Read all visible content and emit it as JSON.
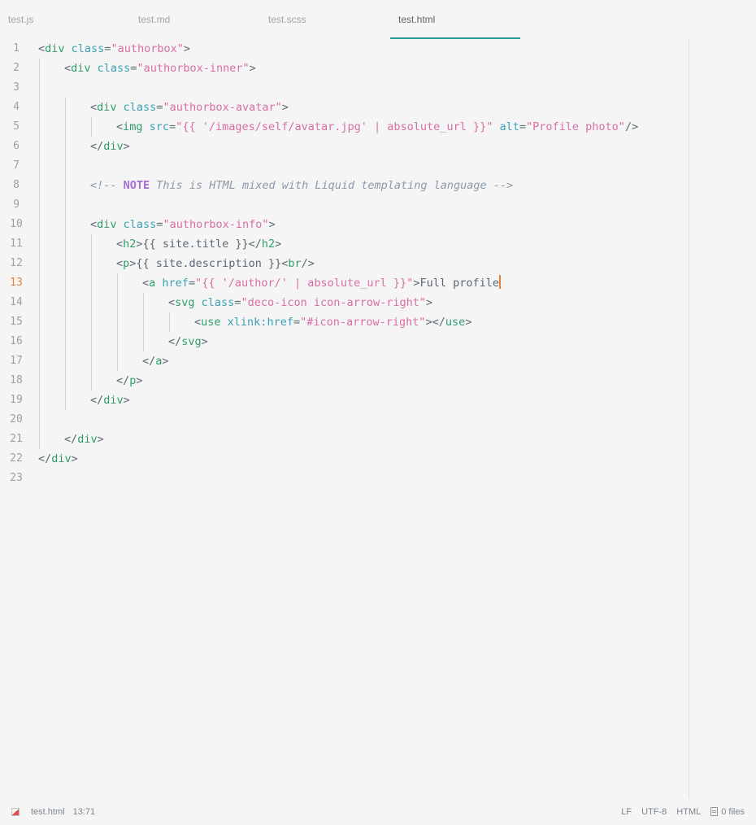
{
  "tabs": [
    {
      "label": "test.js"
    },
    {
      "label": "test.md"
    },
    {
      "label": "test.scss"
    },
    {
      "label": "test.html",
      "active": true
    }
  ],
  "editor": {
    "current_line": 13,
    "line_numbers": [
      "1",
      "2",
      "3",
      "4",
      "5",
      "6",
      "7",
      "8",
      "9",
      "10",
      "11",
      "12",
      "13",
      "14",
      "15",
      "16",
      "17",
      "18",
      "19",
      "20",
      "21",
      "22",
      "23"
    ],
    "lines": [
      {
        "indent": 0,
        "tokens": [
          [
            "punct",
            "<"
          ],
          [
            "tag",
            "div"
          ],
          [
            "text",
            " "
          ],
          [
            "attr",
            "class"
          ],
          [
            "punct",
            "="
          ],
          [
            "str",
            "\"authorbox\""
          ],
          [
            "punct",
            ">"
          ]
        ]
      },
      {
        "indent": 1,
        "tokens": [
          [
            "punct",
            "<"
          ],
          [
            "tag",
            "div"
          ],
          [
            "text",
            " "
          ],
          [
            "attr",
            "class"
          ],
          [
            "punct",
            "="
          ],
          [
            "str",
            "\"authorbox-inner\""
          ],
          [
            "punct",
            ">"
          ]
        ]
      },
      {
        "indent": 0,
        "guides": 1,
        "tokens": []
      },
      {
        "indent": 2,
        "tokens": [
          [
            "punct",
            "<"
          ],
          [
            "tag",
            "div"
          ],
          [
            "text",
            " "
          ],
          [
            "attr",
            "class"
          ],
          [
            "punct",
            "="
          ],
          [
            "str",
            "\"authorbox-avatar\""
          ],
          [
            "punct",
            ">"
          ]
        ]
      },
      {
        "indent": 3,
        "tokens": [
          [
            "punct",
            "<"
          ],
          [
            "tag",
            "img"
          ],
          [
            "text",
            " "
          ],
          [
            "attr",
            "src"
          ],
          [
            "punct",
            "="
          ],
          [
            "str",
            "\"{{ '/images/self/avatar.jpg' | absolute_url }}\""
          ],
          [
            "text",
            " "
          ],
          [
            "attr",
            "alt"
          ],
          [
            "punct",
            "="
          ],
          [
            "str",
            "\"Profile photo\""
          ],
          [
            "punct",
            "/>"
          ]
        ]
      },
      {
        "indent": 2,
        "tokens": [
          [
            "punct",
            "</"
          ],
          [
            "tag",
            "div"
          ],
          [
            "punct",
            ">"
          ]
        ]
      },
      {
        "indent": 0,
        "guides": 2,
        "tokens": []
      },
      {
        "indent": 2,
        "tokens": [
          [
            "comment",
            "<!-- "
          ],
          [
            "note",
            "NOTE"
          ],
          [
            "comment",
            " This is HTML mixed with Liquid templating language -->"
          ]
        ]
      },
      {
        "indent": 0,
        "guides": 2,
        "tokens": []
      },
      {
        "indent": 2,
        "tokens": [
          [
            "punct",
            "<"
          ],
          [
            "tag",
            "div"
          ],
          [
            "text",
            " "
          ],
          [
            "attr",
            "class"
          ],
          [
            "punct",
            "="
          ],
          [
            "str",
            "\"authorbox-info\""
          ],
          [
            "punct",
            ">"
          ]
        ]
      },
      {
        "indent": 3,
        "tokens": [
          [
            "punct",
            "<"
          ],
          [
            "tag",
            "h2"
          ],
          [
            "punct",
            ">"
          ],
          [
            "liquid",
            "{{ site.title }}"
          ],
          [
            "punct",
            "</"
          ],
          [
            "tag",
            "h2"
          ],
          [
            "punct",
            ">"
          ]
        ]
      },
      {
        "indent": 3,
        "tokens": [
          [
            "punct",
            "<"
          ],
          [
            "tag",
            "p"
          ],
          [
            "punct",
            ">"
          ],
          [
            "liquid",
            "{{ site.description }}"
          ],
          [
            "punct",
            "<"
          ],
          [
            "tag",
            "br"
          ],
          [
            "punct",
            "/>"
          ]
        ]
      },
      {
        "indent": 4,
        "tokens": [
          [
            "punct",
            "<"
          ],
          [
            "tag",
            "a"
          ],
          [
            "text",
            " "
          ],
          [
            "attr",
            "href"
          ],
          [
            "punct",
            "="
          ],
          [
            "str",
            "\"{{ '/author/' | absolute_url }}\""
          ],
          [
            "punct",
            ">"
          ],
          [
            "text",
            "Full profile"
          ]
        ]
      },
      {
        "indent": 5,
        "tokens": [
          [
            "punct",
            "<"
          ],
          [
            "tag",
            "svg"
          ],
          [
            "text",
            " "
          ],
          [
            "attr",
            "class"
          ],
          [
            "punct",
            "="
          ],
          [
            "str",
            "\"deco-icon icon-arrow-right\""
          ],
          [
            "punct",
            ">"
          ]
        ]
      },
      {
        "indent": 6,
        "tokens": [
          [
            "punct",
            "<"
          ],
          [
            "tag",
            "use"
          ],
          [
            "text",
            " "
          ],
          [
            "attr",
            "xlink:href"
          ],
          [
            "punct",
            "="
          ],
          [
            "str",
            "\"#icon-arrow-right\""
          ],
          [
            "punct",
            "></"
          ],
          [
            "tag",
            "use"
          ],
          [
            "punct",
            ">"
          ]
        ]
      },
      {
        "indent": 5,
        "tokens": [
          [
            "punct",
            "</"
          ],
          [
            "tag",
            "svg"
          ],
          [
            "punct",
            ">"
          ]
        ]
      },
      {
        "indent": 4,
        "tokens": [
          [
            "punct",
            "</"
          ],
          [
            "tag",
            "a"
          ],
          [
            "punct",
            ">"
          ]
        ]
      },
      {
        "indent": 3,
        "tokens": [
          [
            "punct",
            "</"
          ],
          [
            "tag",
            "p"
          ],
          [
            "punct",
            ">"
          ]
        ]
      },
      {
        "indent": 2,
        "tokens": [
          [
            "punct",
            "</"
          ],
          [
            "tag",
            "div"
          ],
          [
            "punct",
            ">"
          ]
        ]
      },
      {
        "indent": 0,
        "guides": 1,
        "tokens": []
      },
      {
        "indent": 1,
        "tokens": [
          [
            "punct",
            "</"
          ],
          [
            "tag",
            "div"
          ],
          [
            "punct",
            ">"
          ]
        ]
      },
      {
        "indent": 0,
        "tokens": [
          [
            "punct",
            "</"
          ],
          [
            "tag",
            "div"
          ],
          [
            "punct",
            ">"
          ]
        ]
      },
      {
        "indent": 0,
        "tokens": []
      }
    ]
  },
  "status": {
    "file": "test.html",
    "cursor_position": "13:71",
    "line_ending": "LF",
    "encoding": "UTF-8",
    "grammar": "HTML",
    "files": "0 files",
    "dirty_icon": "modified-icon",
    "files_icon": "file-icon"
  },
  "colors": {
    "tag": "#2f9c6c",
    "attribute": "#3aa1b8",
    "string": "#d86ea4",
    "comment": "#8b99a8",
    "note": "#a26dd6",
    "cursor": "#e0823d",
    "tab_accent": "#2a9d97"
  }
}
